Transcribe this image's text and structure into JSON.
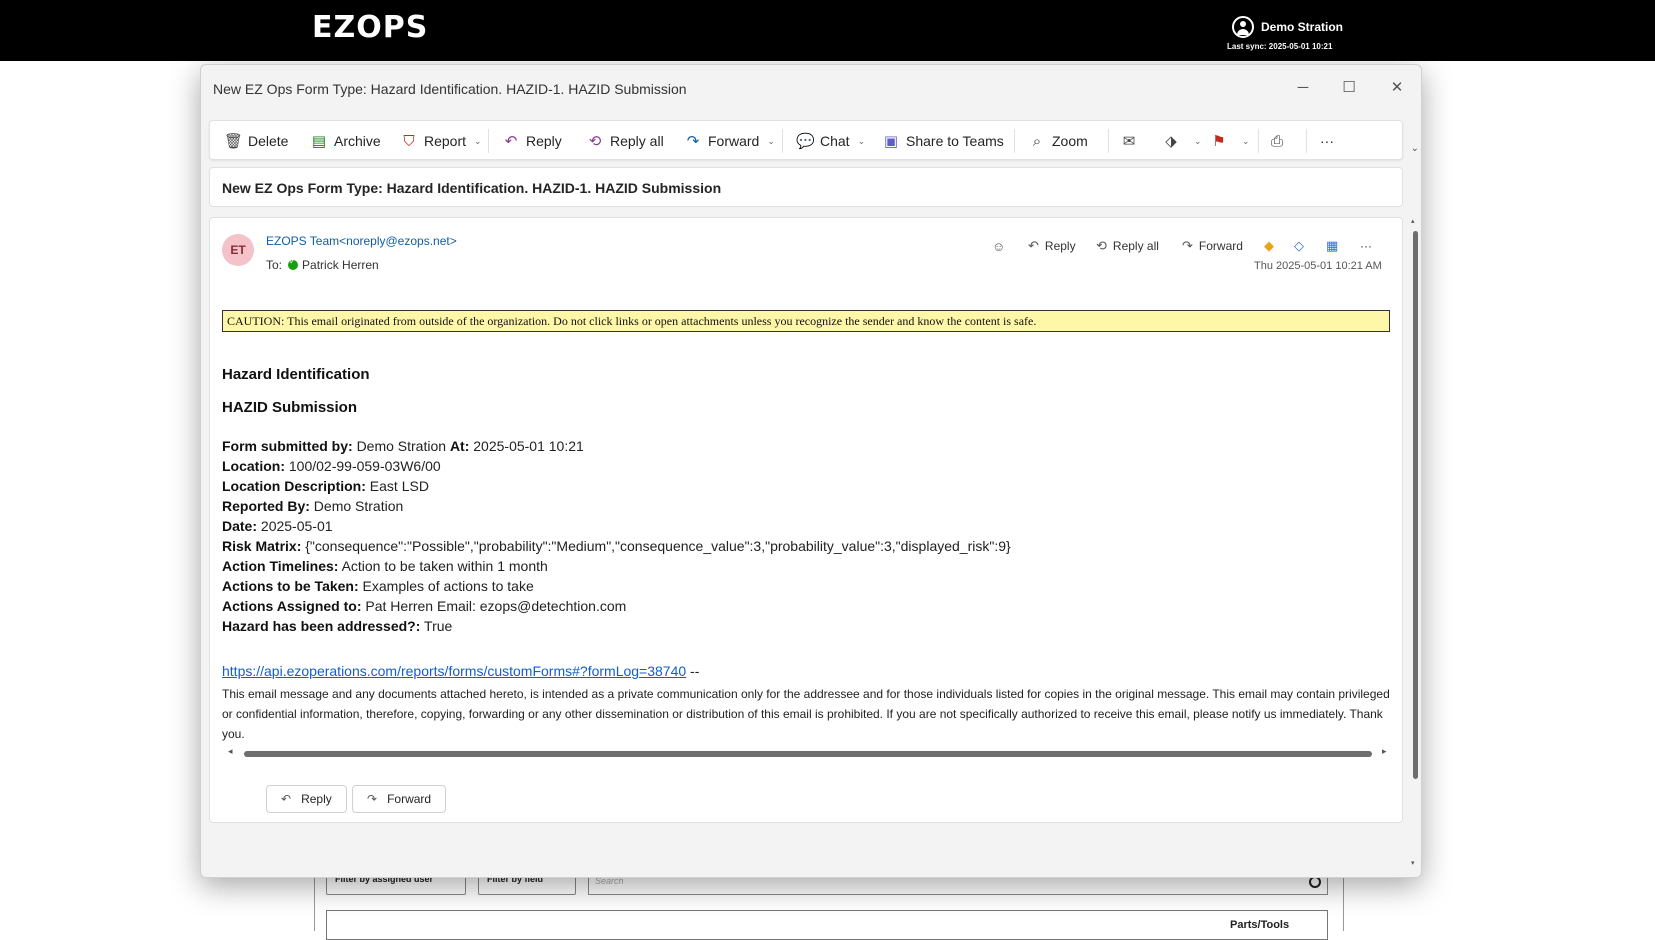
{
  "app": {
    "logo_text": "EZOPS",
    "user_name": "Demo Stration",
    "last_sync": "Last sync: 2025-05-01 10:21",
    "filters": [
      "Filter by assigned user",
      "Filter by field"
    ],
    "search_placeholder": "Search",
    "parts_label": "Parts/Tools"
  },
  "window": {
    "title": "New EZ Ops Form Type: Hazard Identification. HAZID-1. HAZID Submission",
    "controls": {
      "minimize": "─",
      "maximize": "☐",
      "close": "✕"
    }
  },
  "toolbar": {
    "delete": "Delete",
    "archive": "Archive",
    "report": "Report",
    "reply": "Reply",
    "reply_all": "Reply all",
    "forward": "Forward",
    "chat": "Chat",
    "share_teams": "Share to Teams",
    "zoom": "Zoom",
    "more": "···"
  },
  "subject": "New EZ Ops Form Type: Hazard Identification. HAZID-1. HAZID Submission",
  "message": {
    "avatar_initials": "ET",
    "sender": "EZOPS Team<noreply@ezops.net>",
    "to_label": "To:",
    "to_name": "Patrick Herren",
    "date": "Thu 2025-05-01 10:21 AM",
    "actions": {
      "reply": "Reply",
      "reply_all": "Reply all",
      "forward": "Forward",
      "more": "···"
    },
    "caution": "CAUTION: This email originated from outside of the organization. Do not click links or open attachments unless you recognize the sender and know the content is safe.",
    "heading1": "Hazard Identification",
    "heading2": "HAZID Submission",
    "fields": {
      "submitted_by_label": "Form submitted by:",
      "submitted_by": "Demo Stration",
      "at_label": "At:",
      "at": "2025-05-01 10:21",
      "location_label": "Location:",
      "location": "100/02-99-059-03W6/00",
      "location_desc_label": "Location Description:",
      "location_desc": "East LSD",
      "reported_by_label": "Reported By:",
      "reported_by": "Demo Stration",
      "date_label": "Date:",
      "date": "2025-05-01",
      "risk_matrix_label": "Risk Matrix:",
      "risk_matrix": "{\"consequence\":\"Possible\",\"probability\":\"Medium\",\"consequence_value\":3,\"probability_value\":3,\"displayed_risk\":9}",
      "action_timelines_label": "Action Timelines:",
      "action_timelines": "Action to be taken within 1 month",
      "actions_taken_label": "Actions to be Taken:",
      "actions_taken": "Examples of actions to take",
      "actions_assigned_label": "Actions Assigned to:",
      "actions_assigned": "Pat Herren Email: ezops@detechtion.com",
      "hazard_addressed_label": "Hazard has been addressed?:",
      "hazard_addressed": "True"
    },
    "link": "https://api.ezoperations.com/reports/forms/customForms#?formLog=38740",
    "link_suffix": " --",
    "disclaimer": "This email message and any documents attached hereto, is intended as a private communication only for the addressee and for those individuals listed for copies in the original message. This email may contain privileged or confidential information, therefore, copying, forwarding or any other dissemination or distribution of this email is prohibited. If you are not specifically authorized to receive this email, please notify us immediately. Thank you.",
    "footer_reply": "Reply",
    "footer_forward": "Forward"
  }
}
